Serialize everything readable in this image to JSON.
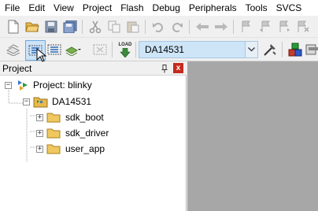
{
  "menu": [
    "File",
    "Edit",
    "View",
    "Project",
    "Flash",
    "Debug",
    "Peripherals",
    "Tools",
    "SVCS"
  ],
  "toolbar1": {
    "icons": [
      "new-file-icon",
      "open-folder-icon",
      "save-icon",
      "save-all-icon",
      "cut-icon",
      "copy-icon",
      "paste-icon",
      "undo-icon",
      "redo-icon",
      "navigate-back-icon",
      "navigate-forward-icon",
      "bookmark-icon",
      "bookmark-prev-icon",
      "bookmark-next-icon",
      "clear-bookmarks-icon"
    ]
  },
  "toolbar2": {
    "load_label": "LOAD",
    "target": "DA14531"
  },
  "project_panel": {
    "title": "Project",
    "close": "x",
    "root": "Project: blinky",
    "target": "DA14531",
    "groups": [
      "sdk_boot",
      "sdk_driver",
      "user_app"
    ]
  }
}
